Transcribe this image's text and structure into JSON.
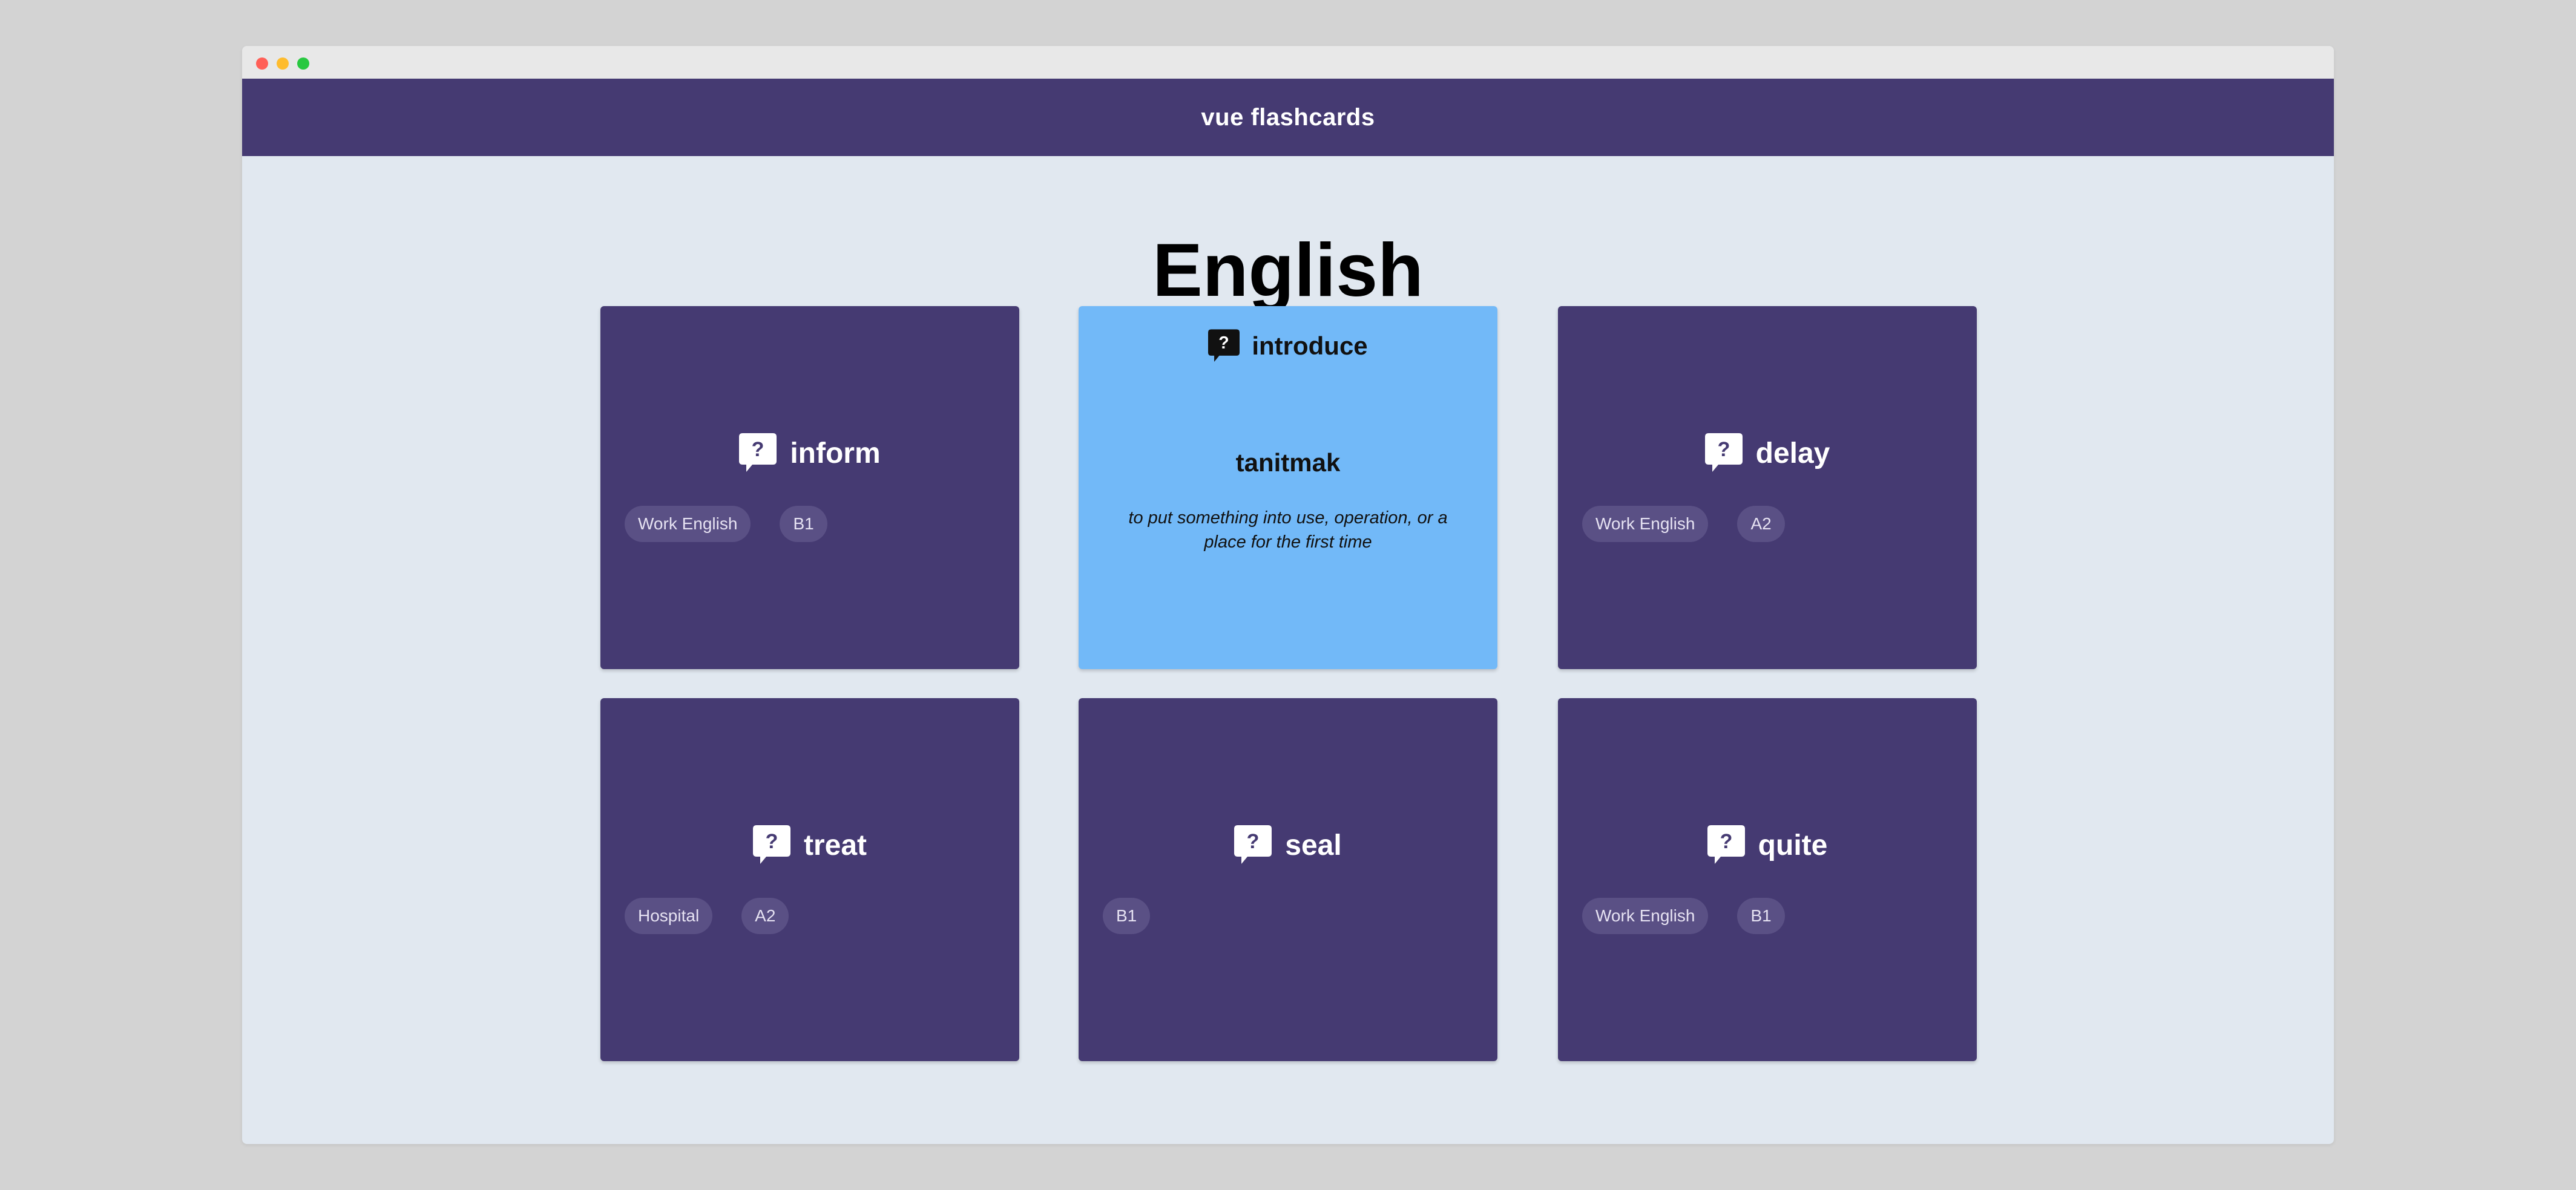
{
  "app": {
    "brand": "vue flashcards",
    "page_title": "English"
  },
  "colors": {
    "card": "#453a72",
    "card_flipped": "#72b9f8",
    "navbar": "#453a72",
    "page_background": "#e1e8f0",
    "tag_background": "#5a5085"
  },
  "icons": {
    "card_word": "question-bubble-icon"
  },
  "cards": [
    {
      "word": "inform",
      "tags": [
        "Work English",
        "B1"
      ]
    },
    {
      "word": "introduce",
      "translation": "tanitmak",
      "definition": "to put something into use, operation, or a place for the first time"
    },
    {
      "word": "delay",
      "tags": [
        "Work English",
        "A2"
      ]
    },
    {
      "word": "treat",
      "tags": [
        "Hospital",
        "A2"
      ]
    },
    {
      "word": "seal",
      "tags": [
        "B1"
      ]
    },
    {
      "word": "quite",
      "tags": [
        "Work English",
        "B1"
      ]
    }
  ]
}
